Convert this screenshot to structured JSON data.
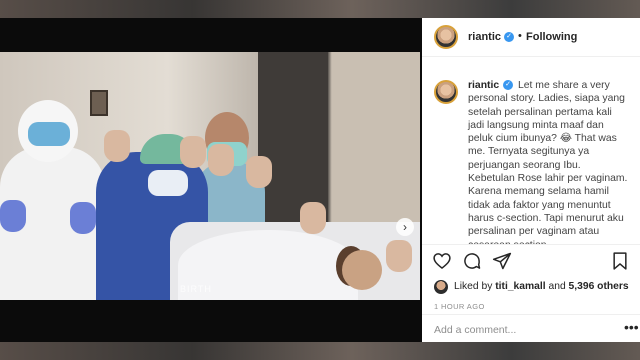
{
  "post": {
    "image_watermark": "BIRTH",
    "next_glyph": "›"
  },
  "header": {
    "username": "riantic",
    "verified_glyph": "✓",
    "separator": "•",
    "follow_status": "Following"
  },
  "caption": {
    "username": "riantic",
    "text": "Let me share a very personal story. Ladies, siapa yang setelah persalinan pertama kali jadi langsung minta maaf dan peluk cium ibunya? 😂 That was me. Ternyata segitunya ya perjuangan seorang Ibu. Kebetulan Rose lahir per vaginam. Karena memang selama hamil tidak ada faktor yang menuntut harus c-section. Tapi menurut aku persalinan per vaginam atau cesarean section"
  },
  "actions": {
    "like_icon": "heart-icon",
    "comment_icon": "comment-icon",
    "share_icon": "share-icon",
    "save_icon": "bookmark-icon"
  },
  "likes": {
    "prefix": "Liked by",
    "user": "titi_kamall",
    "conjunction": "and",
    "count": "5,396 others"
  },
  "timestamp": "1 HOUR AGO",
  "comment_box": {
    "placeholder": "Add a comment...",
    "more_glyph": "•••"
  },
  "colors": {
    "verified": "#3897f0",
    "panel_bg": "#ffffff",
    "overlay": "#0b0b0b"
  }
}
